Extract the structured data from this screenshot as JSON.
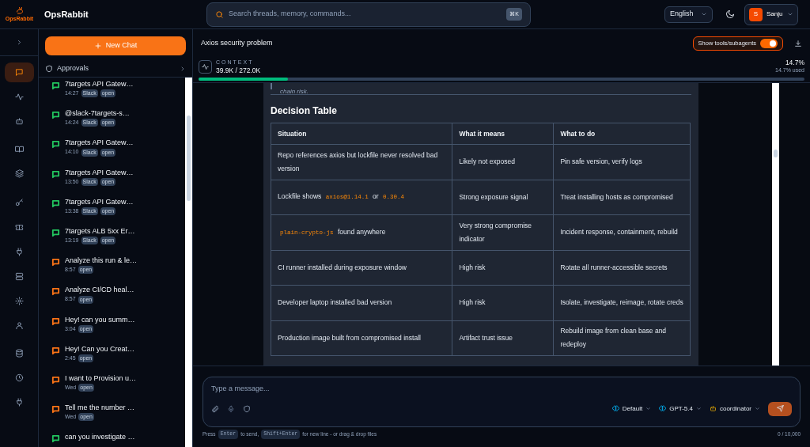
{
  "app": {
    "name": "OpsRabbit",
    "logo_text": "OpsRabbit"
  },
  "search": {
    "placeholder": "Search threads, memory, commands...",
    "shortcut": "⌘K"
  },
  "language": {
    "value": "English"
  },
  "user": {
    "initial": "S",
    "name": "Sanju"
  },
  "rail": {
    "items": [
      {
        "selected": true
      },
      {
        "selected": false
      },
      {
        "selected": false
      },
      {
        "selected": false
      },
      {
        "selected": false
      },
      {
        "selected": false
      },
      {
        "selected": false
      },
      {
        "selected": false
      },
      {
        "selected": false
      },
      {
        "selected": false
      },
      {
        "selected": false
      },
      {
        "selected": false
      },
      {
        "selected": false
      },
      {
        "selected": false
      }
    ]
  },
  "sidebar": {
    "new_chat": "New Chat",
    "approvals": "Approvals",
    "threads": [
      {
        "title": "7targets API Gatew…",
        "time": "14:27",
        "tags": [
          "Slack",
          "open"
        ],
        "color": "#22c55e"
      },
      {
        "title": "@slack-7targets-s…",
        "time": "14:24",
        "tags": [
          "Slack",
          "open"
        ],
        "color": "#22c55e"
      },
      {
        "title": "7targets API Gatew…",
        "time": "14:10",
        "tags": [
          "Slack",
          "open"
        ],
        "color": "#22c55e"
      },
      {
        "title": "7targets API Gatew…",
        "time": "13:50",
        "tags": [
          "Slack",
          "open"
        ],
        "color": "#22c55e"
      },
      {
        "title": "7targets API Gatew…",
        "time": "13:38",
        "tags": [
          "Slack",
          "open"
        ],
        "color": "#22c55e"
      },
      {
        "title": "7targets ALB 5xx Er…",
        "time": "13:19",
        "tags": [
          "Slack",
          "open"
        ],
        "color": "#22c55e"
      },
      {
        "title": "Analyze this run & le…",
        "time": "8:57",
        "tags": [
          "open"
        ],
        "color": "#f97316"
      },
      {
        "title": "Analyze CI/CD heal…",
        "time": "8:57",
        "tags": [
          "open"
        ],
        "color": "#f97316"
      },
      {
        "title": "Hey! can you summ…",
        "time": "3:04",
        "tags": [
          "open"
        ],
        "color": "#f97316"
      },
      {
        "title": "Hey! Can you Creat…",
        "time": "2:45",
        "tags": [
          "open"
        ],
        "color": "#f97316"
      },
      {
        "title": "I want to Provision u…",
        "time": "Wed",
        "tags": [
          "open"
        ],
        "color": "#f97316"
      },
      {
        "title": "Tell me the number …",
        "time": "Wed",
        "tags": [
          "open"
        ],
        "color": "#f97316"
      },
      {
        "title": "can you investigate …",
        "color": "#22c55e"
      }
    ]
  },
  "chat": {
    "title": "Axios security problem",
    "toggle": {
      "label": "Show tools/subagents",
      "on": true
    },
    "context": {
      "label": "CONTEXT",
      "value": "39.9K / 272.0K",
      "percent": "14.7%",
      "used": "14.7% used",
      "level": 0.147
    },
    "message": {
      "quote": "chain risk.",
      "heading": "Decision Table",
      "table": {
        "columns": [
          "Situation",
          "What it means",
          "What to do"
        ],
        "rows": [
          [
            [
              "Repo references axios but lockfile never resolved bad version"
            ],
            "Likely not exposed",
            "Pin safe version, verify logs"
          ],
          [
            [
              {
                "kind": "text",
                "text": "Lockfile shows "
              },
              {
                "kind": "code",
                "text": "axios@1.14.1"
              },
              {
                "kind": "text",
                "text": " or "
              },
              {
                "kind": "code",
                "text": "0.30.4"
              }
            ],
            "Strong exposure signal",
            "Treat installing hosts as compromised"
          ],
          [
            [
              {
                "kind": "code",
                "text": "plain-crypto-js"
              },
              {
                "kind": "text",
                "text": " found anywhere"
              }
            ],
            "Very strong compromise indicator",
            "Incident response, containment, rebuild"
          ],
          [
            [
              "CI runner installed during exposure window"
            ],
            "High risk",
            "Rotate all runner-accessible secrets"
          ],
          [
            [
              "Developer laptop installed bad version"
            ],
            "High risk",
            "Isolate, investigate, reimage, rotate creds"
          ],
          [
            [
              "Production image built from compromised install"
            ],
            "Artifact trust issue",
            "Rebuild image from clean base and redeploy"
          ]
        ]
      }
    }
  },
  "composer": {
    "placeholder": "Type a message...",
    "mode": "Default",
    "model": "GPT-5.4",
    "agent": "coordinator",
    "hint": [
      {
        "kind": "text",
        "text": "Press"
      },
      {
        "kind": "kbd",
        "text": "Enter"
      },
      {
        "kind": "text",
        "text": "to send,"
      },
      {
        "kind": "kbd",
        "text": "Shift+Enter"
      },
      {
        "kind": "text",
        "text": "for new line - or drag & drop files"
      }
    ],
    "counter": "0 / 10,000"
  }
}
